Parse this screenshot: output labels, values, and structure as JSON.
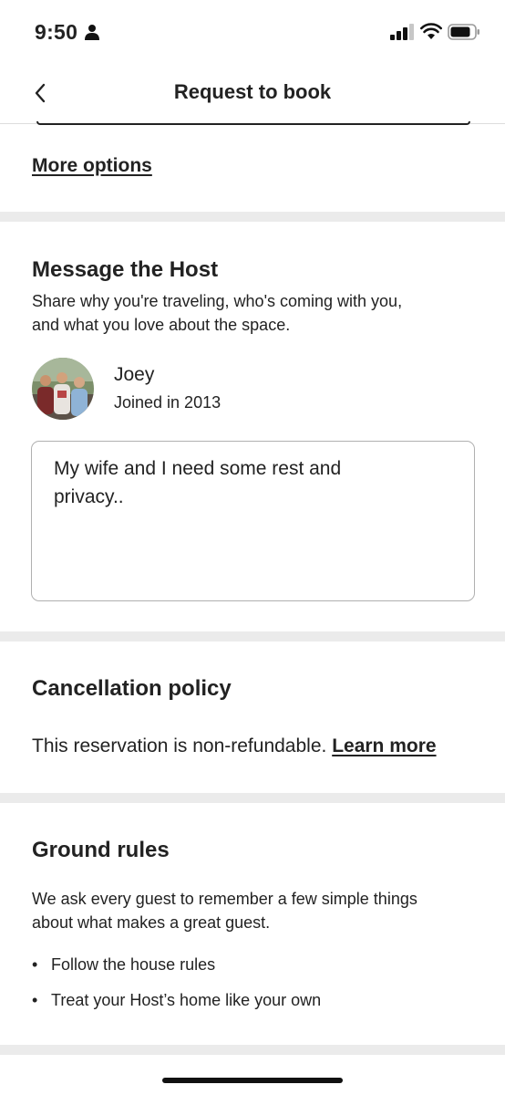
{
  "status_bar": {
    "time": "9:50"
  },
  "nav": {
    "title": "Request to book"
  },
  "more_options": "More options",
  "message_host": {
    "title": "Message the Host",
    "description_line1": "Share why you're traveling, who's coming with you,",
    "description_line2": "and what you love about the space.",
    "host_name": "Joey",
    "host_joined": "Joined in 2013",
    "message_line1": "My wife and I need some rest and",
    "message_line2": "privacy.."
  },
  "cancellation": {
    "title": "Cancellation policy",
    "text": "This reservation is non-refundable.",
    "link": "Learn more"
  },
  "ground_rules": {
    "title": "Ground rules",
    "intro_line1": "We ask every guest to remember a few simple things",
    "intro_line2": "about what makes a great guest.",
    "items": [
      "Follow the house rules",
      "Treat your Host’s home like your own"
    ]
  },
  "colors": {
    "text": "#222222",
    "divider": "#ebebeb",
    "border": "#b0b0b0"
  }
}
